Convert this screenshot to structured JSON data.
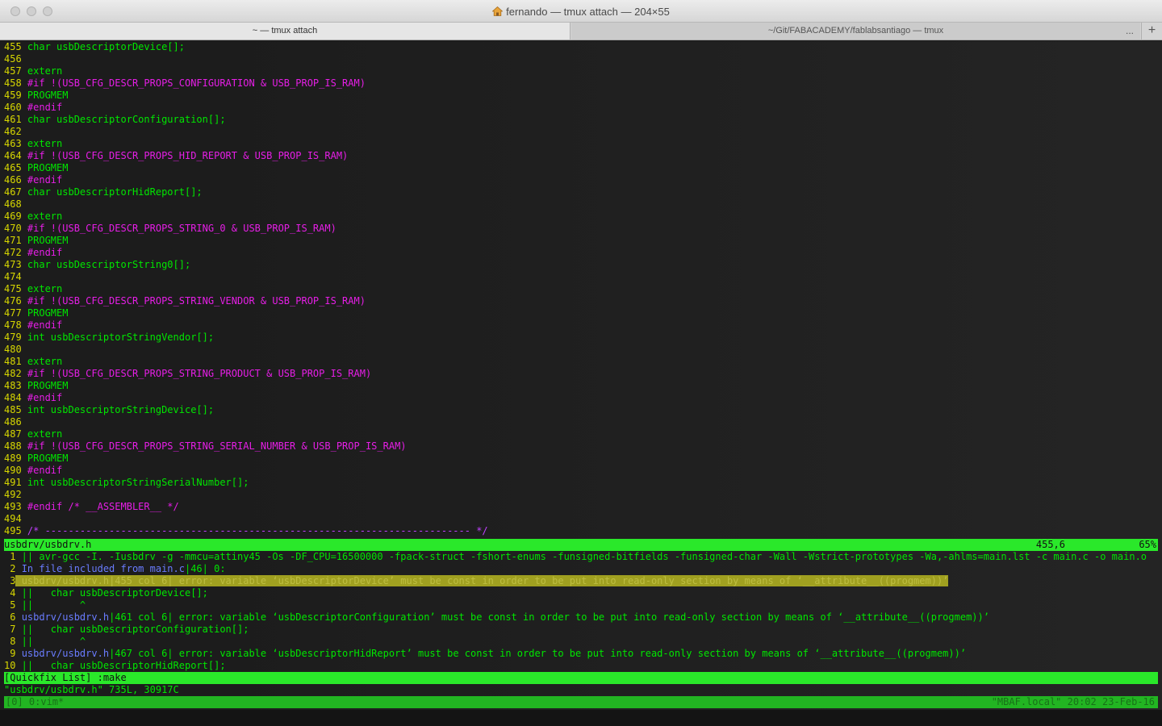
{
  "window": {
    "title": "fernando — tmux attach — 204×55"
  },
  "tabs": [
    {
      "label": "~ — tmux attach"
    },
    {
      "label": "~/Git/FABACADEMY/fablabsantiago — tmux"
    }
  ],
  "tab_overflow": "...",
  "tab_add": "+",
  "code_lines": [
    {
      "n": "455",
      "t": "t-plain",
      "text": " char usbDescriptorDevice[];"
    },
    {
      "n": "456",
      "t": "t-plain",
      "text": ""
    },
    {
      "n": "457",
      "t": "t-keyword",
      "text": " extern"
    },
    {
      "n": "458",
      "t": "t-pre",
      "text": " #if !(USB_CFG_DESCR_PROPS_CONFIGURATION & USB_PROP_IS_RAM)"
    },
    {
      "n": "459",
      "t": "t-keyword",
      "text": " PROGMEM"
    },
    {
      "n": "460",
      "t": "t-pre",
      "text": " #endif"
    },
    {
      "n": "461",
      "t": "t-plain",
      "text": " char usbDescriptorConfiguration[];"
    },
    {
      "n": "462",
      "t": "t-plain",
      "text": ""
    },
    {
      "n": "463",
      "t": "t-keyword",
      "text": " extern"
    },
    {
      "n": "464",
      "t": "t-pre",
      "text": " #if !(USB_CFG_DESCR_PROPS_HID_REPORT & USB_PROP_IS_RAM)"
    },
    {
      "n": "465",
      "t": "t-keyword",
      "text": " PROGMEM"
    },
    {
      "n": "466",
      "t": "t-pre",
      "text": " #endif"
    },
    {
      "n": "467",
      "t": "t-plain",
      "text": " char usbDescriptorHidReport[];"
    },
    {
      "n": "468",
      "t": "t-plain",
      "text": ""
    },
    {
      "n": "469",
      "t": "t-keyword",
      "text": " extern"
    },
    {
      "n": "470",
      "t": "t-pre",
      "text": " #if !(USB_CFG_DESCR_PROPS_STRING_0 & USB_PROP_IS_RAM)"
    },
    {
      "n": "471",
      "t": "t-keyword",
      "text": " PROGMEM"
    },
    {
      "n": "472",
      "t": "t-pre",
      "text": " #endif"
    },
    {
      "n": "473",
      "t": "t-plain",
      "text": " char usbDescriptorString0[];"
    },
    {
      "n": "474",
      "t": "t-plain",
      "text": ""
    },
    {
      "n": "475",
      "t": "t-keyword",
      "text": " extern"
    },
    {
      "n": "476",
      "t": "t-pre",
      "text": " #if !(USB_CFG_DESCR_PROPS_STRING_VENDOR & USB_PROP_IS_RAM)"
    },
    {
      "n": "477",
      "t": "t-keyword",
      "text": " PROGMEM"
    },
    {
      "n": "478",
      "t": "t-pre",
      "text": " #endif"
    },
    {
      "n": "479",
      "t": "t-plain",
      "text": " int usbDescriptorStringVendor[];"
    },
    {
      "n": "480",
      "t": "t-plain",
      "text": ""
    },
    {
      "n": "481",
      "t": "t-keyword",
      "text": " extern"
    },
    {
      "n": "482",
      "t": "t-pre",
      "text": " #if !(USB_CFG_DESCR_PROPS_STRING_PRODUCT & USB_PROP_IS_RAM)"
    },
    {
      "n": "483",
      "t": "t-keyword",
      "text": " PROGMEM"
    },
    {
      "n": "484",
      "t": "t-pre",
      "text": " #endif"
    },
    {
      "n": "485",
      "t": "t-plain",
      "text": " int usbDescriptorStringDevice[];"
    },
    {
      "n": "486",
      "t": "t-plain",
      "text": ""
    },
    {
      "n": "487",
      "t": "t-keyword",
      "text": " extern"
    },
    {
      "n": "488",
      "t": "t-pre",
      "text": " #if !(USB_CFG_DESCR_PROPS_STRING_SERIAL_NUMBER & USB_PROP_IS_RAM)"
    },
    {
      "n": "489",
      "t": "t-keyword",
      "text": " PROGMEM"
    },
    {
      "n": "490",
      "t": "t-pre",
      "text": " #endif"
    },
    {
      "n": "491",
      "t": "t-plain",
      "text": " int usbDescriptorStringSerialNumber[];"
    },
    {
      "n": "492",
      "t": "t-plain",
      "text": ""
    },
    {
      "n": "493",
      "t": "t-pre",
      "text": " #endif /* __ASSEMBLER__ */"
    },
    {
      "n": "494",
      "t": "t-plain",
      "text": ""
    },
    {
      "n": "495",
      "t": "t-comment",
      "text": " /* ------------------------------------------------------------------------- */"
    }
  ],
  "statusline": {
    "file": "usbdrv/usbdrv.h",
    "position": "455,6",
    "percent": "65%"
  },
  "quickfix": [
    {
      "n": " 1",
      "file": "",
      "text": " || avr-gcc -I. -Iusbdrv -g -mmcu=attiny45 -Os -DF_CPU=16500000 -fpack-struct -fshort-enums -funsigned-bitfields -funsigned-char -Wall -Wstrict-prototypes -Wa,-ahlms=main.lst -c main.c -o main.o",
      "selected": false
    },
    {
      "n": " 2",
      "file": "In file included from main.c",
      "text": "|46| 0:",
      "selected": false
    },
    {
      "n": " 3",
      "file": "usbdrv/usbdrv.h",
      "text": "|455 col 6| error: variable ‘usbDescriptorDevice’ must be const in order to be put into read-only section by means of ‘__attribute__((progmem))’",
      "selected": true
    },
    {
      "n": " 4",
      "file": "",
      "text": " ||   char usbDescriptorDevice[];",
      "selected": false
    },
    {
      "n": " 5",
      "file": "",
      "text": " ||        ^",
      "selected": false
    },
    {
      "n": " 6",
      "file": "usbdrv/usbdrv.h",
      "text": "|461 col 6| error: variable ‘usbDescriptorConfiguration’ must be const in order to be put into read-only section by means of ‘__attribute__((progmem))’",
      "selected": false
    },
    {
      "n": " 7",
      "file": "",
      "text": " ||   char usbDescriptorConfiguration[];",
      "selected": false
    },
    {
      "n": " 8",
      "file": "",
      "text": " ||        ^",
      "selected": false
    },
    {
      "n": " 9",
      "file": "usbdrv/usbdrv.h",
      "text": "|467 col 6| error: variable ‘usbDescriptorHidReport’ must be const in order to be put into read-only section by means of ‘__attribute__((progmem))’",
      "selected": false
    },
    {
      "n": "10",
      "file": "",
      "text": " ||   char usbDescriptorHidReport[];",
      "selected": false
    }
  ],
  "quickfix_status": "[Quickfix List] :make",
  "cmdline": "\"usbdrv/usbdrv.h\" 735L, 30917C",
  "tmux": {
    "left": "[0] 0:vim*",
    "right": "\"MBAF.local\" 20:02 23-Feb-16"
  }
}
